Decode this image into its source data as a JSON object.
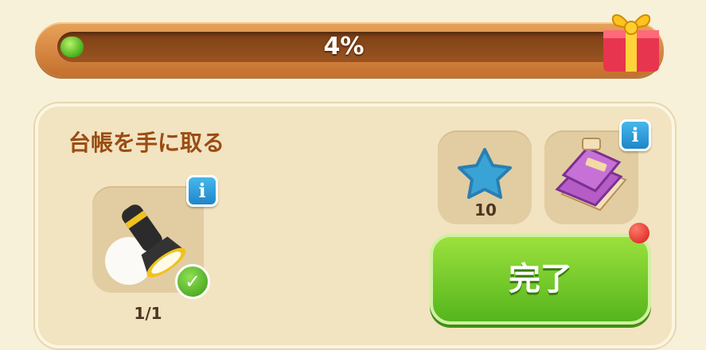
{
  "progress": {
    "label": "4%",
    "fraction": 0.04
  },
  "task": {
    "title": "台帳を手に取る",
    "item_count": "1/1"
  },
  "reward": {
    "star_count": "10"
  },
  "done_button": {
    "label": "完了"
  },
  "info_label": "i",
  "check_label": "✓",
  "colors": {
    "accent_green": "#55b51c",
    "panel_bg": "#f2e3c1",
    "title_brown": "#9a4d12",
    "info_blue": "#1f86c9"
  }
}
